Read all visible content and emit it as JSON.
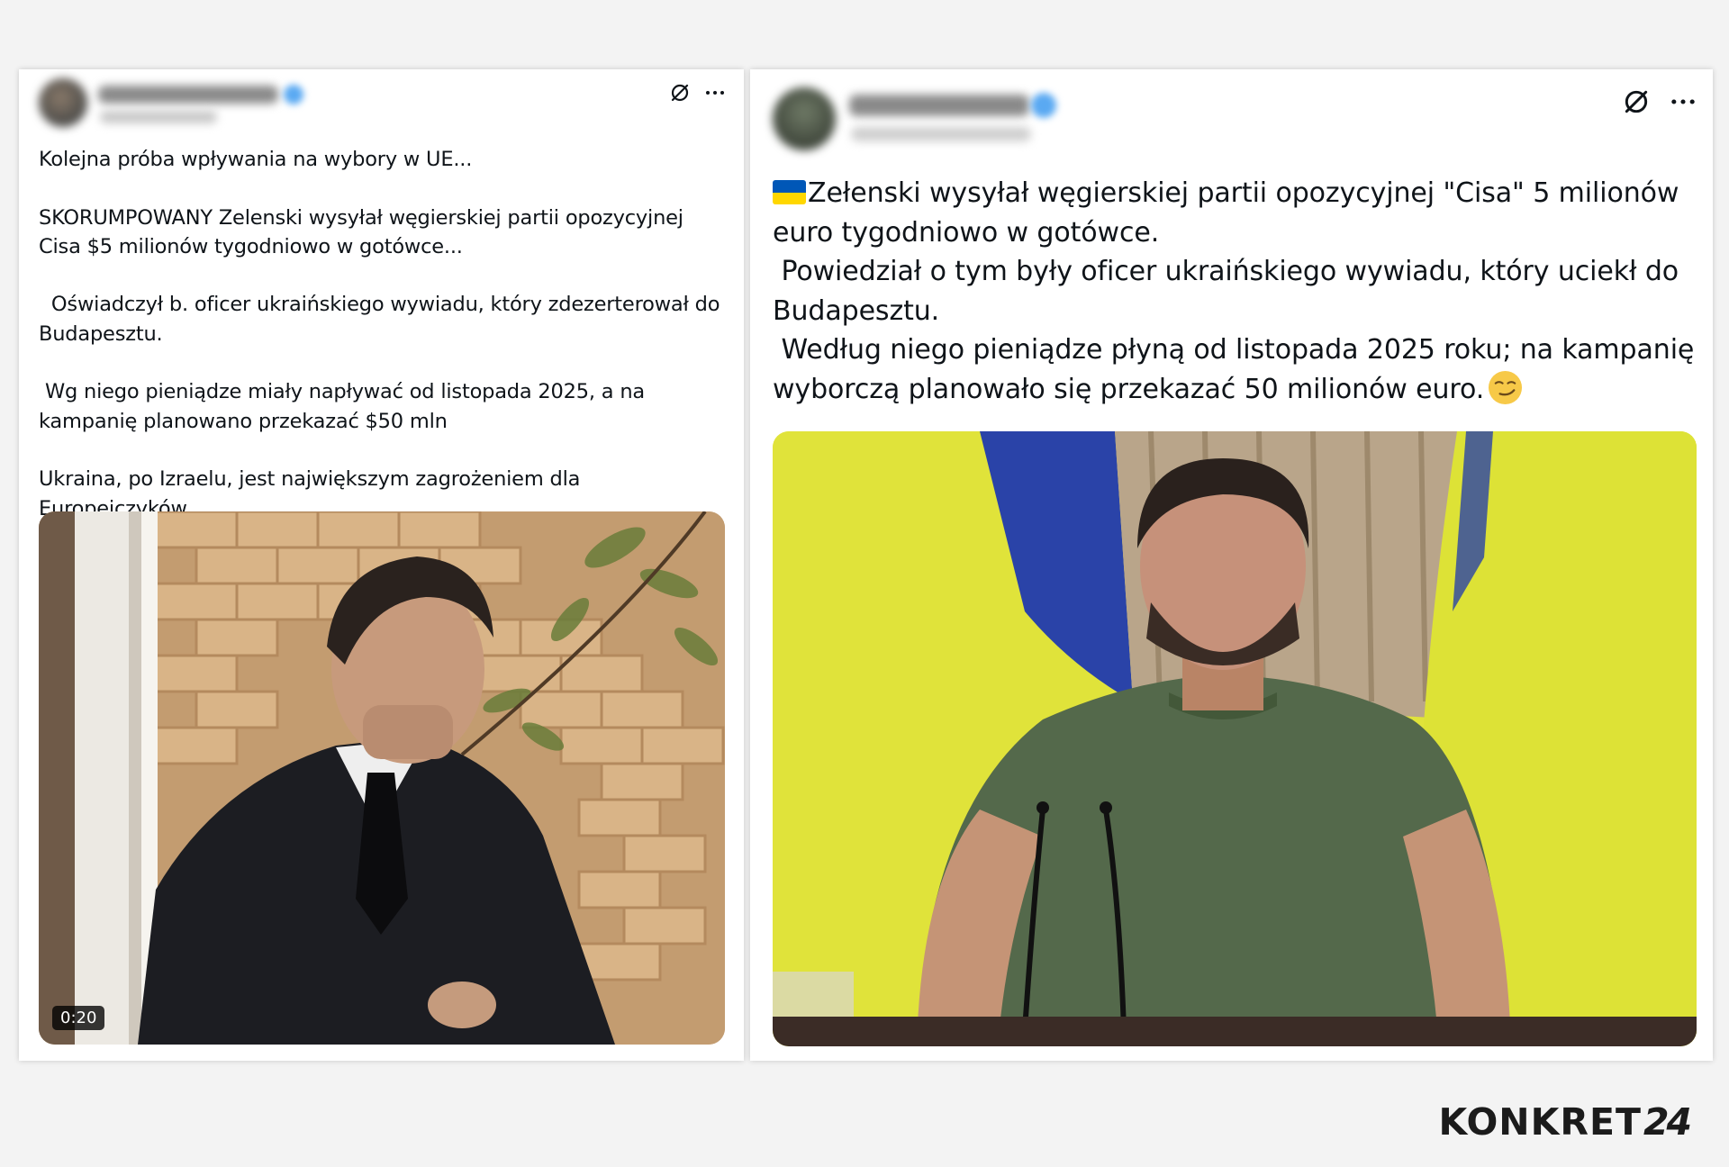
{
  "post_left": {
    "text": "Kolejna próba wpływania na wybory w UE...\n\nSKORUMPOWANY Zelenski wysyłał węgierskiej partii opozycyjnej Cisa $5 milionów tygodniowo w gotówce...\n\n  Oświadczył b. oficer ukraińskiego wywiadu, który zdezerterował do Budapesztu.\n\n Wg niego pieniądze miały napływać od listopada 2025, a na kampanię planowano przekazać $50 mln\n\nUkraina, po Izraelu, jest największym zagrożeniem dla Europejczyków...",
    "video_duration": "0:20",
    "icons": [
      "grok-icon",
      "more-icon"
    ]
  },
  "post_right": {
    "text_main": "Zełenski wysyłał węgierskiej partii opozycyjnej \"Cisa\" 5 milionów euro tygodniowo w gotówce.\n Powiedział o tym były oficer ukraińskiego wywiadu, który uciekł do Budapesztu.\n Według niego pieniądze płyną od listopada 2025 roku; na kampanię wyborczą planowało się przekazać 50 milionów euro.",
    "icons": [
      "ukraine-flag-emoji",
      "smirk-emoji",
      "grok-icon",
      "more-icon"
    ]
  },
  "watermark": {
    "brand": "KONKRET",
    "number": "24"
  },
  "colors": {
    "flag_blue": "#0057b7",
    "flag_yellow": "#ffd700",
    "verified_blue": "#1d9bf0",
    "text": "#0f1419"
  }
}
